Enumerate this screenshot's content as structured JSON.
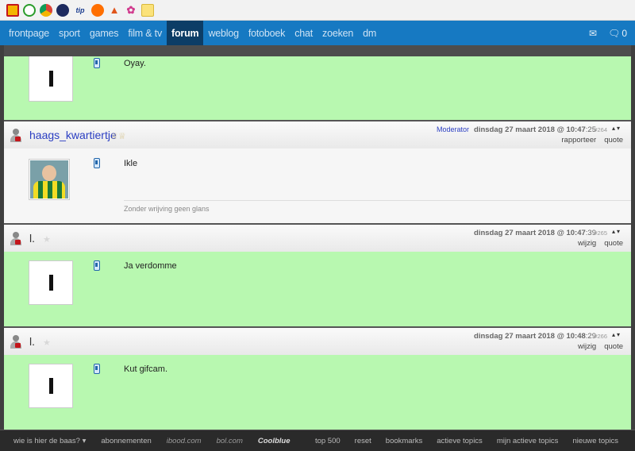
{
  "bookmarks": [
    {
      "icon": "bookmark-a-icon",
      "label": ""
    },
    {
      "icon": "clock-icon",
      "label": ""
    },
    {
      "icon": "chrome-icon",
      "label": ""
    },
    {
      "icon": "circle-logo-icon",
      "label": ""
    },
    {
      "icon": "tip-logo-icon",
      "label": "tip"
    },
    {
      "icon": "orange-logo-icon",
      "label": ""
    },
    {
      "icon": "torch-icon",
      "label": ""
    },
    {
      "icon": "flower-icon",
      "label": ""
    },
    {
      "icon": "folder-icon",
      "label": ""
    }
  ],
  "nav": {
    "items": [
      "frontpage",
      "sport",
      "games",
      "film & tv",
      "forum",
      "weblog",
      "fotoboek",
      "chat",
      "zoeken",
      "dm"
    ],
    "active": "forum",
    "icons": [
      "mail-icon",
      "chat-bubble-icon"
    ],
    "chat_count": "0"
  },
  "posts": [
    {
      "message": "Oyay."
    },
    {
      "username": "haags_kwartiertje",
      "role": "Moderator",
      "date": "dinsdag 27 maart 2018 @ 10:47",
      "seconds": ":25",
      "number": "#264",
      "actions": [
        "rapporteer",
        "quote"
      ],
      "message": "Ikle",
      "signature": "Zonder wrijving geen glans"
    },
    {
      "username": "l.",
      "date": "dinsdag 27 maart 2018 @ 10:47",
      "seconds": ":39",
      "number": "#265",
      "actions": [
        "wijzig",
        "quote"
      ],
      "message": "Ja verdomme"
    },
    {
      "username": "l.",
      "date": "dinsdag 27 maart 2018 @ 10:48",
      "seconds": ":29",
      "number": "#266",
      "actions": [
        "wijzig",
        "quote"
      ],
      "message": "Kut gifcam."
    }
  ],
  "footer": {
    "left": [
      "wie is hier de baas? ▾",
      "abonnementen",
      "ibood.com",
      "bol.com",
      "Coolblue"
    ],
    "right": [
      "top 500",
      "reset",
      "bookmarks",
      "actieve topics",
      "mijn actieve topics",
      "nieuwe topics"
    ]
  },
  "colors": {
    "nav_bg": "#1679c2",
    "nav_active_bg": "#0c3d66",
    "green_post": "#b8f8b0",
    "username_link": "#2b3ec2"
  }
}
